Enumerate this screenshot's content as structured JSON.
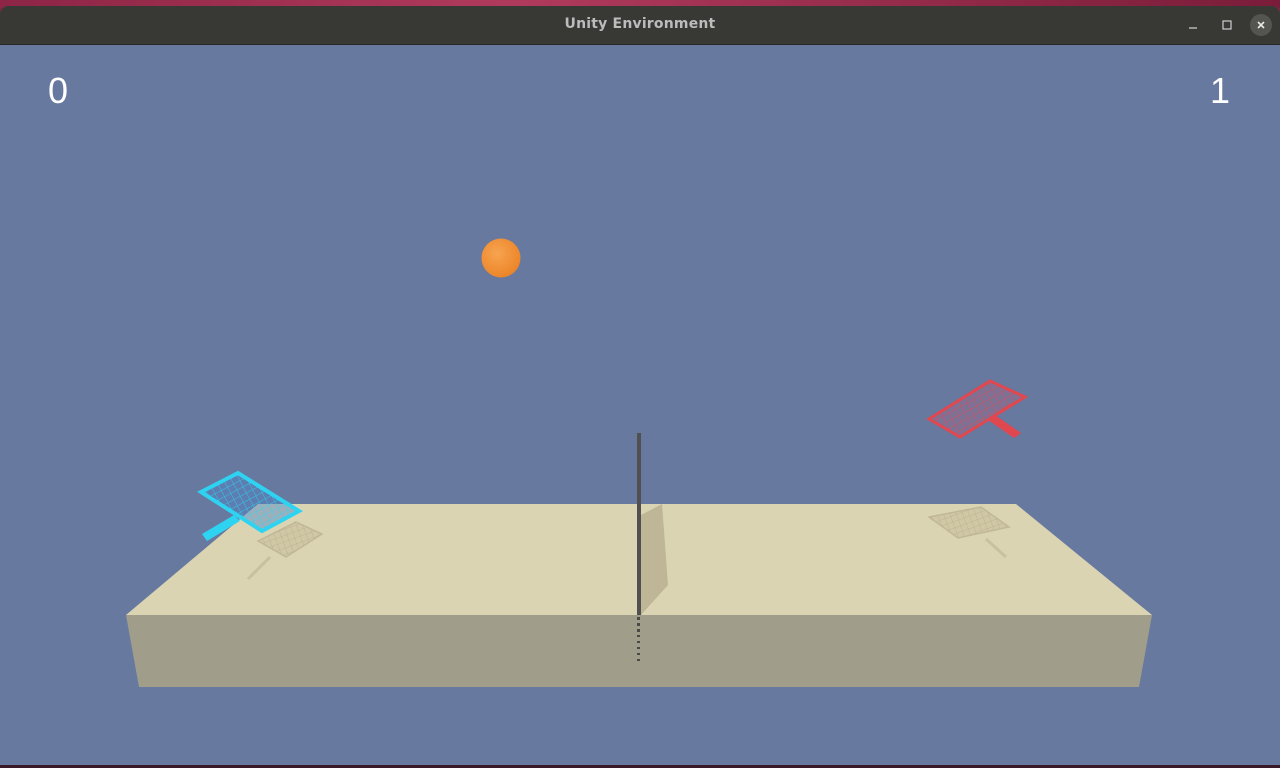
{
  "window": {
    "title": "Unity Environment"
  },
  "controls": {
    "minimize_icon": "minimize-icon",
    "maximize_icon": "maximize-icon",
    "close_icon": "close-icon"
  },
  "scores": {
    "left": "0",
    "right": "1"
  },
  "colors": {
    "sky": "#67799f",
    "table_top": "#dbd4b3",
    "table_front": "#a09e8b",
    "ball": "#f39035",
    "left_racket": "#2fd3f2",
    "right_racket": "#e0474f",
    "titlebar": "#383835"
  }
}
